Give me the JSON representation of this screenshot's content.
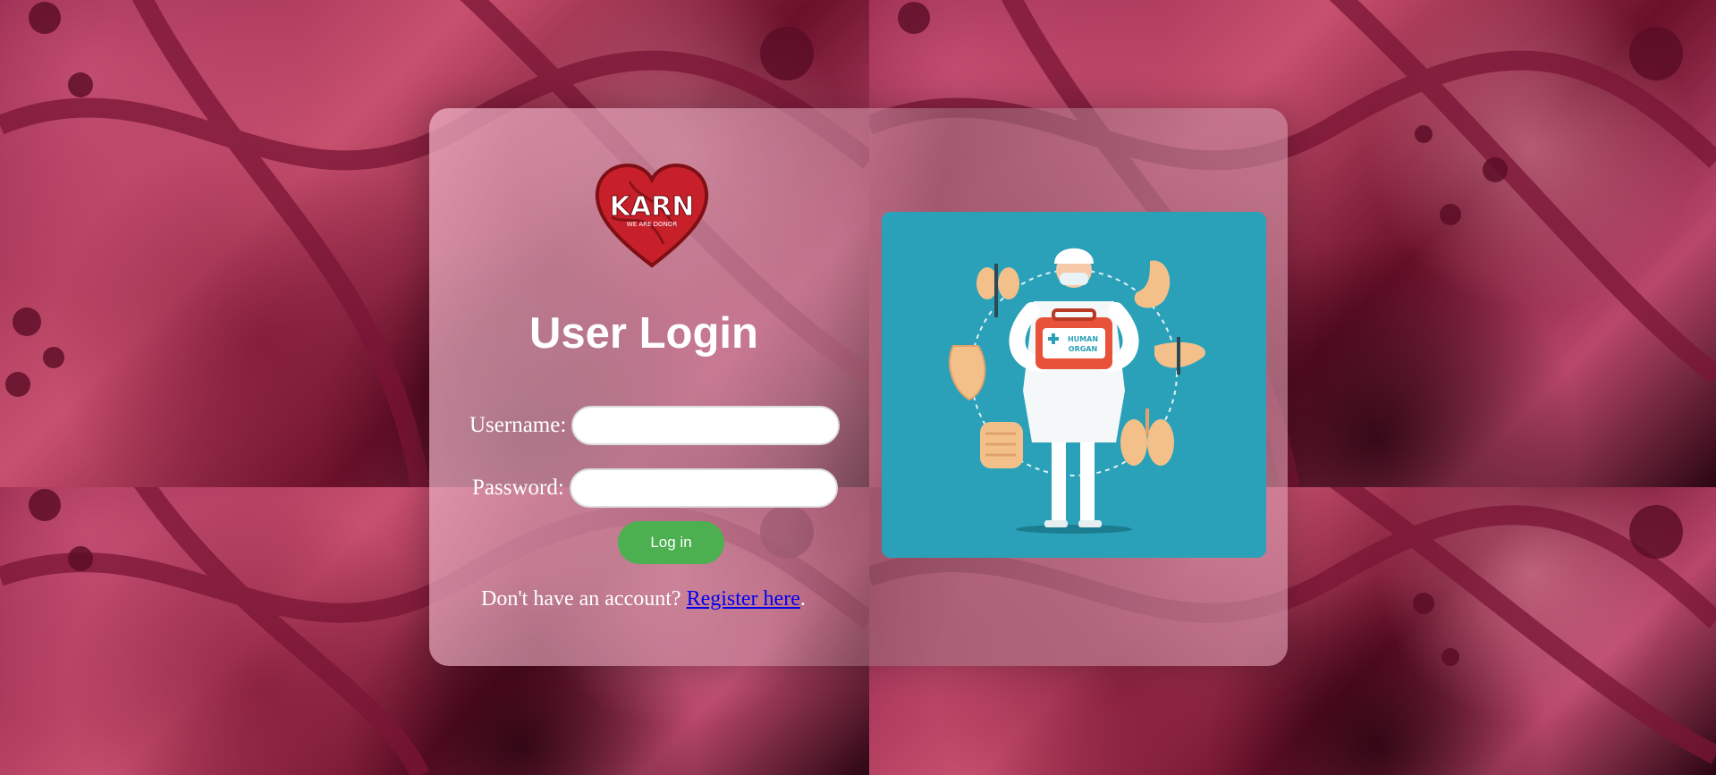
{
  "page": {
    "title": "User Login"
  },
  "logo": {
    "brand": "KARN",
    "tagline": "WE ARE DONOR"
  },
  "form": {
    "username_label": "Username:",
    "password_label": "Password:",
    "username_value": "",
    "password_value": "",
    "login_label": "Log in"
  },
  "register": {
    "prompt": "Don't have an account? ",
    "link_text": "Register here",
    "suffix": "."
  },
  "illustration": {
    "case_label_line1": "HUMAN",
    "case_label_line2": "ORGAN"
  },
  "colors": {
    "login_button": "#4caf50",
    "illustration_bg": "#2aa1b8",
    "link": "#0000ee"
  },
  "icons": [
    "heart-logo-icon",
    "doctor-illustration-icon"
  ]
}
